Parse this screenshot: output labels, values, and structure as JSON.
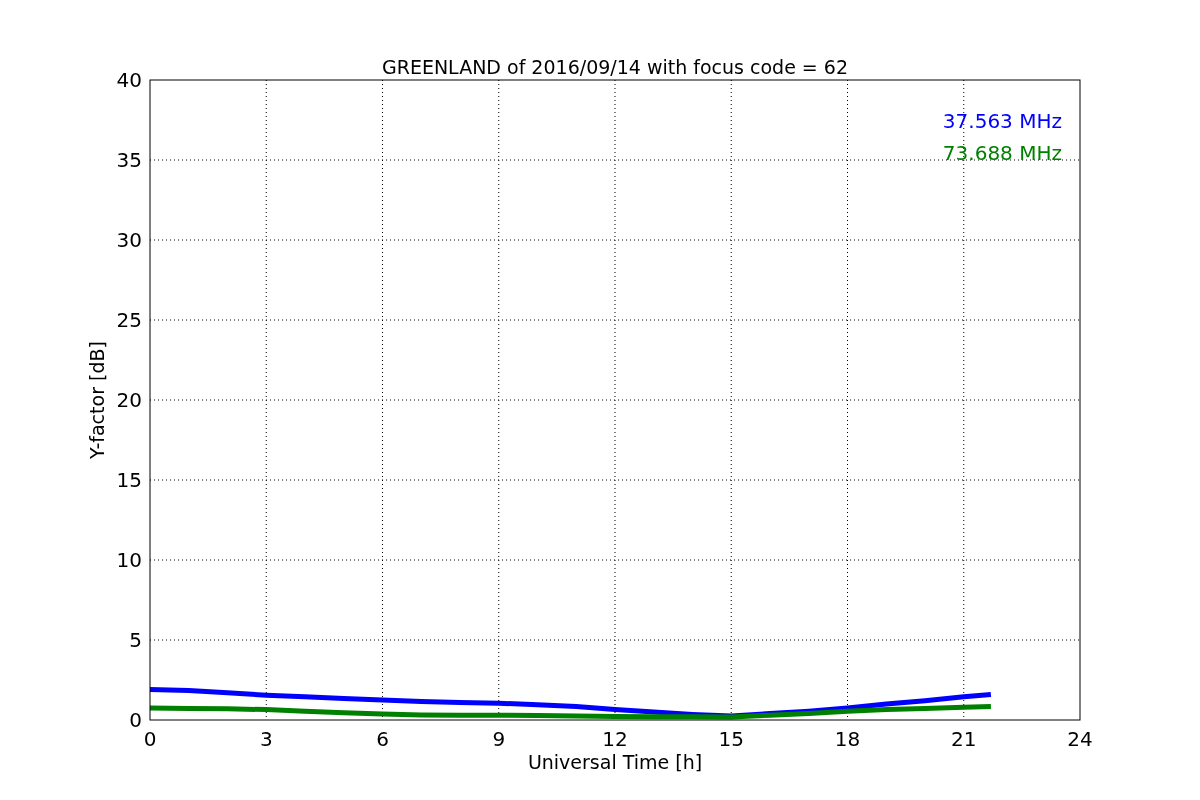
{
  "chart_data": {
    "type": "line",
    "title": "GREENLAND of 2016/09/14 with focus code = 62",
    "xlabel": "Universal Time [h]",
    "ylabel": "Y-factor [dB]",
    "x": [
      0,
      1,
      2,
      3,
      4,
      5,
      6,
      7,
      8,
      9,
      10,
      11,
      12,
      13,
      14,
      15,
      16,
      17,
      18,
      19,
      20,
      21,
      21.7
    ],
    "series": [
      {
        "name": "37.563 MHz",
        "color": "#0000ff",
        "values": [
          1.9,
          1.85,
          1.7,
          1.55,
          1.45,
          1.35,
          1.25,
          1.15,
          1.1,
          1.05,
          0.95,
          0.85,
          0.65,
          0.5,
          0.35,
          0.25,
          0.4,
          0.55,
          0.75,
          1.0,
          1.2,
          1.45,
          1.6
        ]
      },
      {
        "name": "73.688 MHz",
        "color": "#008000",
        "values": [
          0.75,
          0.72,
          0.7,
          0.65,
          0.55,
          0.45,
          0.38,
          0.32,
          0.3,
          0.3,
          0.28,
          0.25,
          0.22,
          0.2,
          0.2,
          0.18,
          0.3,
          0.4,
          0.55,
          0.65,
          0.72,
          0.8,
          0.85
        ]
      }
    ],
    "xlim": [
      0,
      24
    ],
    "ylim": [
      0,
      40
    ],
    "xticks": [
      0,
      3,
      6,
      9,
      12,
      15,
      18,
      21,
      24
    ],
    "yticks": [
      0,
      5,
      10,
      15,
      20,
      25,
      30,
      35,
      40
    ],
    "grid": true
  }
}
